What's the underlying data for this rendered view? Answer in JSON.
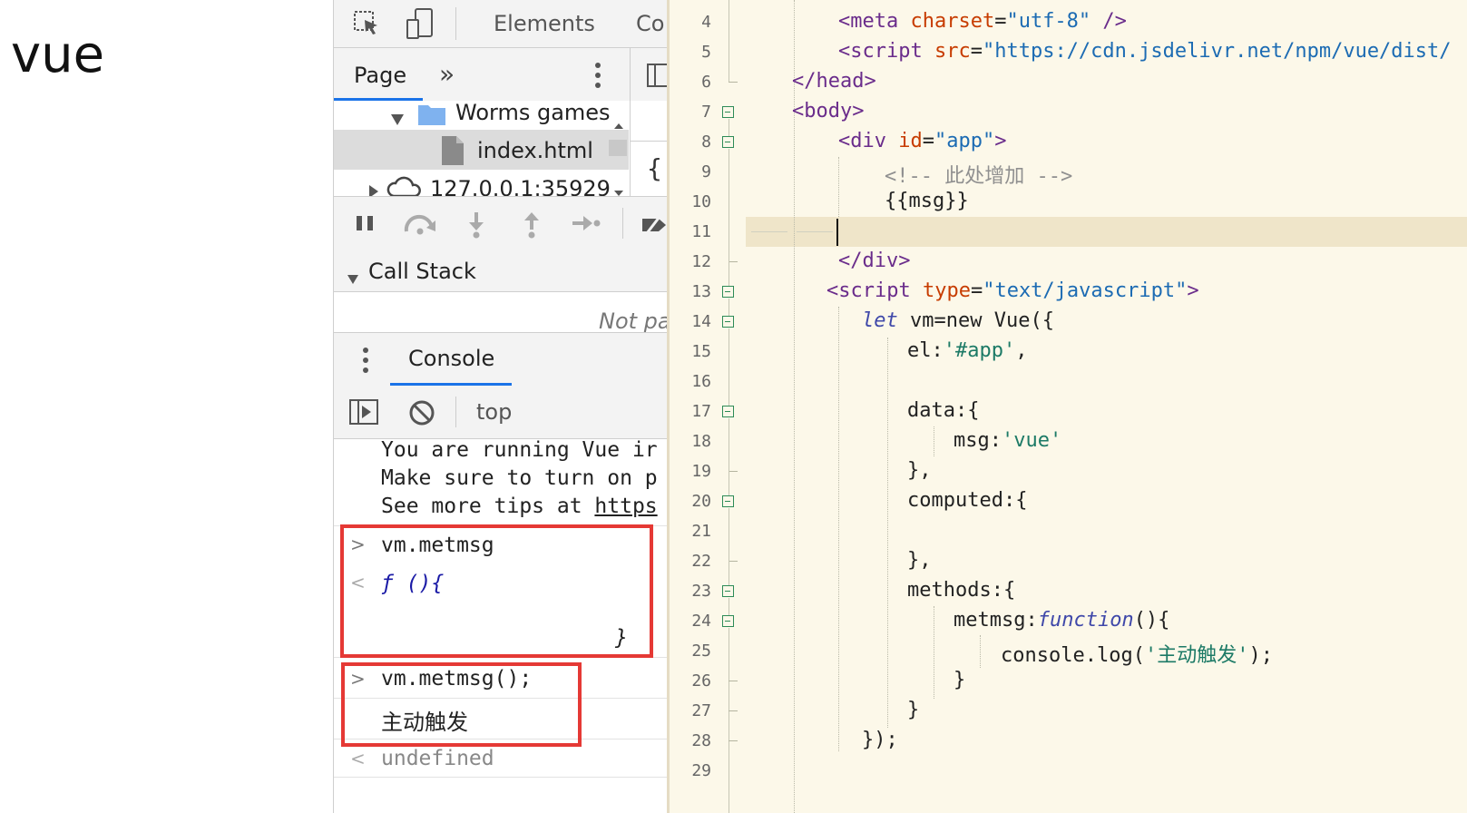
{
  "page_output": {
    "text": "vue"
  },
  "devtools": {
    "top_tabs": [
      "Elements",
      "Co"
    ],
    "nav": {
      "tab": "Page",
      "more": "»"
    },
    "tree": [
      {
        "label": "Worms games",
        "type": "folder"
      },
      {
        "label": "index.html",
        "type": "file"
      },
      {
        "label": "127.0.0.1:35929",
        "type": "domain"
      }
    ],
    "call_stack": {
      "title": "Call Stack",
      "status": "Not pa"
    },
    "console_tab": "Console",
    "context": "top",
    "messages": [
      "You are running Vue ir",
      "Make sure to turn on p",
      "See more tips at "
    ],
    "link_text": "https",
    "entries": [
      {
        "prompt": ">",
        "input": "vm.metmsg"
      },
      {
        "prompt": "<",
        "output_fn": "ƒ (){",
        "close": "}"
      },
      {
        "prompt": ">",
        "input": "vm.metmsg();"
      },
      {
        "log": "主动触发"
      },
      {
        "prompt": "<",
        "output": "undefined"
      }
    ]
  },
  "editor": {
    "lines": [
      {
        "n": "4"
      },
      {
        "n": "5"
      },
      {
        "n": "6"
      },
      {
        "n": "7"
      },
      {
        "n": "8"
      },
      {
        "n": "9"
      },
      {
        "n": "10"
      },
      {
        "n": "11"
      },
      {
        "n": "12"
      },
      {
        "n": "13"
      },
      {
        "n": "14"
      },
      {
        "n": "15"
      },
      {
        "n": "16"
      },
      {
        "n": "17"
      },
      {
        "n": "18"
      },
      {
        "n": "19"
      },
      {
        "n": "20"
      },
      {
        "n": "21"
      },
      {
        "n": "22"
      },
      {
        "n": "23"
      },
      {
        "n": "24"
      },
      {
        "n": "25"
      },
      {
        "n": "26"
      },
      {
        "n": "27"
      },
      {
        "n": "28"
      },
      {
        "n": "29"
      }
    ],
    "code": {
      "l4_tag": "<meta",
      "l4_attr": "charset",
      "l4_eq": "=",
      "l4_val": "\"utf-8\"",
      "l4_end": " />",
      "l5_tag": "<script",
      "l5_attr": "src",
      "l5_eq": "=",
      "l5_val": "\"https://cdn.jsdelivr.net/npm/vue/dist/",
      "l6": "</head>",
      "l7": "<body>",
      "l8_tag": "<div",
      "l8_attr": "id",
      "l8_eq": "=",
      "l8_val": "\"app\"",
      "l8_end": ">",
      "l9": "<!-- 此处增加 -->",
      "l10": "{{msg}}",
      "l12": "</div>",
      "l13_tag": "<script",
      "l13_attr": "type",
      "l13_eq": "=",
      "l13_val": "\"text/javascript\"",
      "l13_end": ">",
      "l14_kw": "let",
      "l14_rest": " vm=new Vue({",
      "l15_a": "el:",
      "l15_b": "'#app'",
      "l15_c": ",",
      "l17": "data:{",
      "l18_a": "msg:",
      "l18_b": "'vue'",
      "l19": "},",
      "l20": "computed:{",
      "l22": "},",
      "l23": "methods:{",
      "l24_a": "metmsg:",
      "l24_kw": "function",
      "l24_b": "(){",
      "l25_a": "console.log(",
      "l25_b": "'主动触发'",
      "l25_c": ");",
      "l26": "}",
      "l27": "}",
      "l28": "});"
    }
  }
}
